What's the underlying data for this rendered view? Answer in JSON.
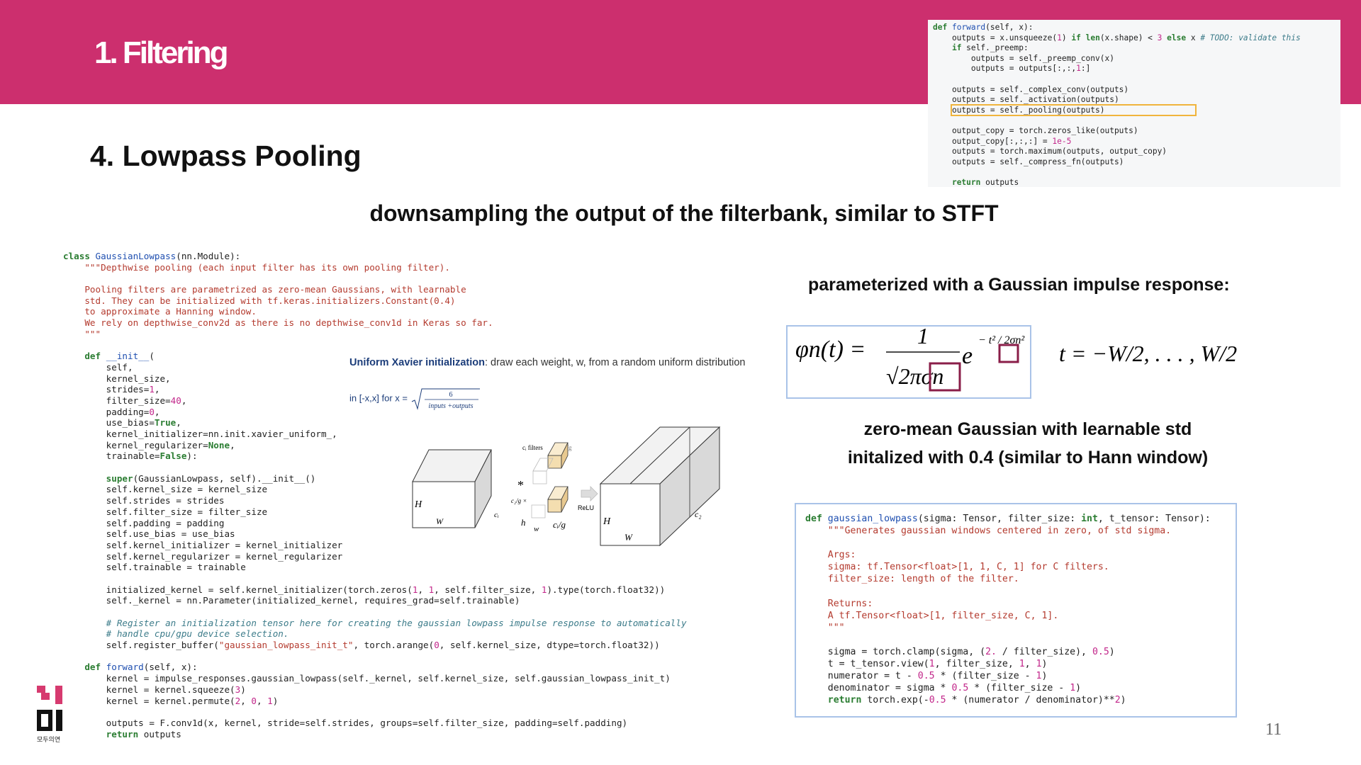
{
  "header": {
    "title": "1. Filtering",
    "bg_color": "#cc2f6e"
  },
  "section_title": "4. Lowpass Pooling",
  "subtitle": "downsampling the output of the filterbank, similar to STFT",
  "param_title": "parameterized with a Gaussian impulse response:",
  "formula": {
    "lhs": "φn(t) =",
    "numerator": "1",
    "denominator": "√2πσn",
    "exp_base": "e",
    "exponent": "− t² / 2σn²",
    "range": "t = −W/2, . . . , W/2"
  },
  "zero_mean_line1": "zero-mean Gaussian with learnable std",
  "zero_mean_line2": "initalized with 0.4 (similar to Hann window)",
  "xavier": {
    "title": "Uniform Xavier initialization",
    "desc": ": draw each weight, w, from a random uniform distribution",
    "range_prefix": "in [-x,x] for x = ",
    "frac_num": "6",
    "frac_den": "inputs +outputs"
  },
  "figure": {
    "H_left": "H",
    "W_left": "W",
    "c_left": "cᵢ",
    "filters_label": "cᵢ filters",
    "groups_top": "× c₂/g",
    "star": "*",
    "groups_side": "c₂/g ×",
    "h_label": "h",
    "w_label": "w",
    "ci_g": "cᵢ/g",
    "relu": "ReLU",
    "H_right": "H",
    "W_right": "W",
    "c_right": "c₂"
  },
  "page_number": "11",
  "logo_text": "모두의연"
}
